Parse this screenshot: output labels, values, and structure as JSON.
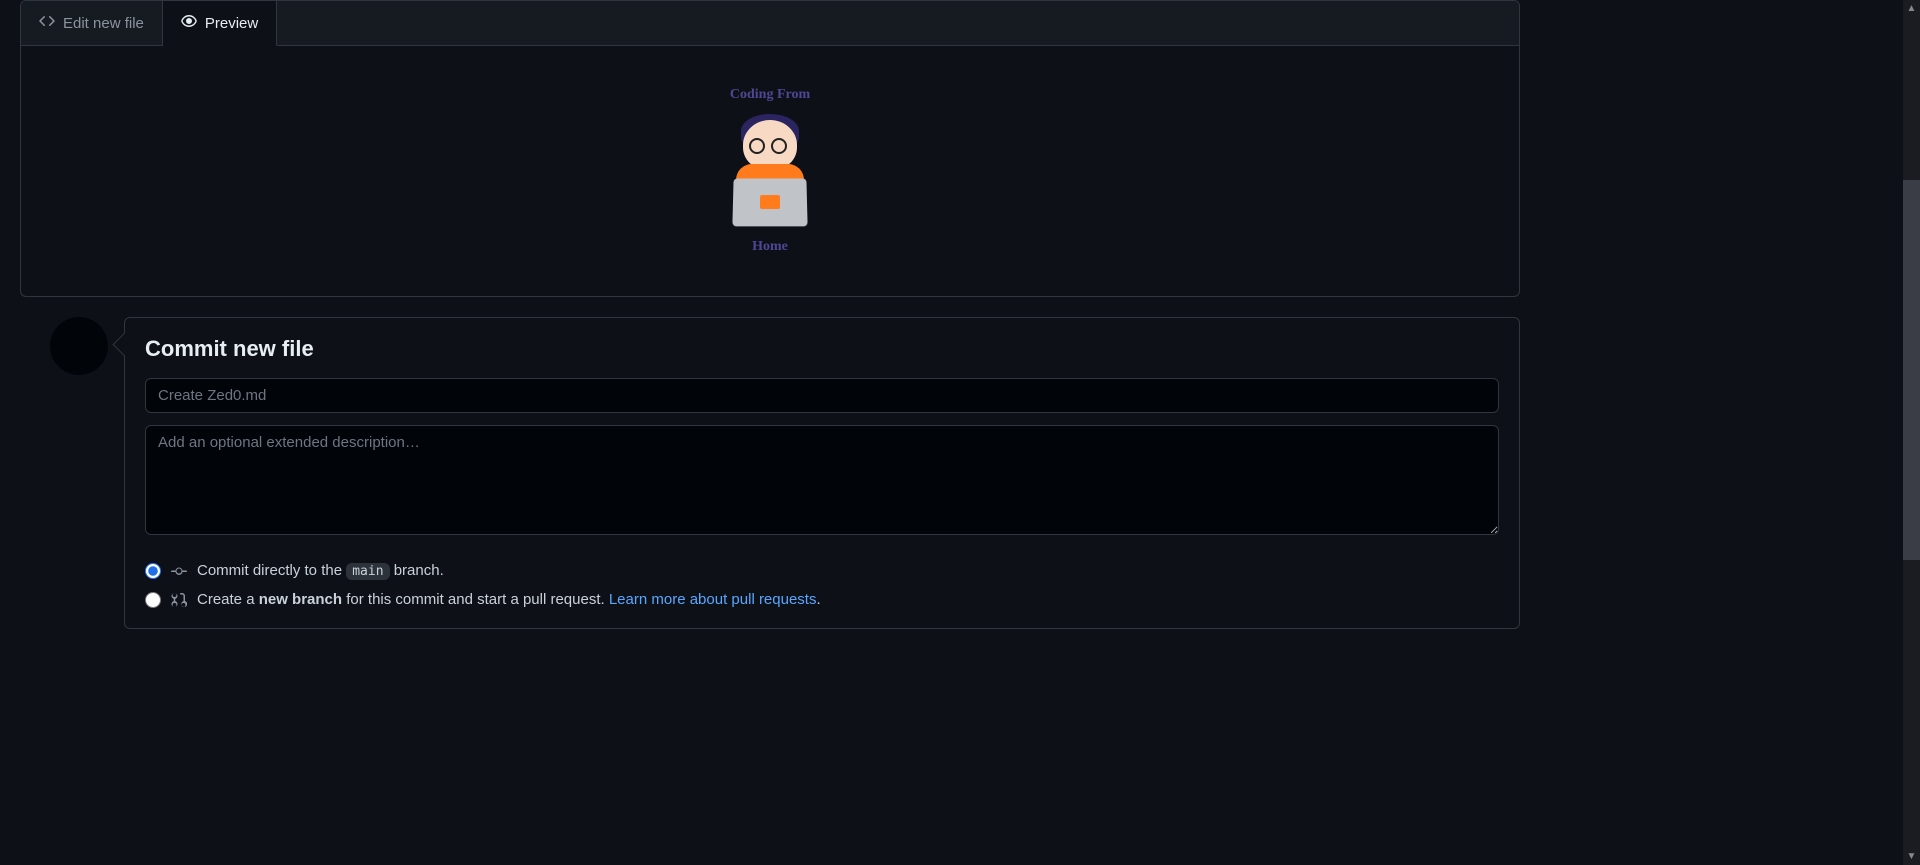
{
  "tabs": {
    "edit_label": "Edit new file",
    "preview_label": "Preview"
  },
  "preview": {
    "curved_top": "Coding From",
    "curved_bottom": "Home"
  },
  "commit": {
    "heading": "Commit new file",
    "summary_placeholder": "Create Zed0.md",
    "description_placeholder": "Add an optional extended description…",
    "option_direct_prefix": "Commit directly to the ",
    "branch_name": "main",
    "option_direct_suffix": " branch.",
    "option_newbranch_prefix": "Create a ",
    "option_newbranch_strong": "new branch",
    "option_newbranch_suffix": " for this commit and start a pull request. ",
    "learn_link": "Learn more about pull requests",
    "period": "."
  }
}
